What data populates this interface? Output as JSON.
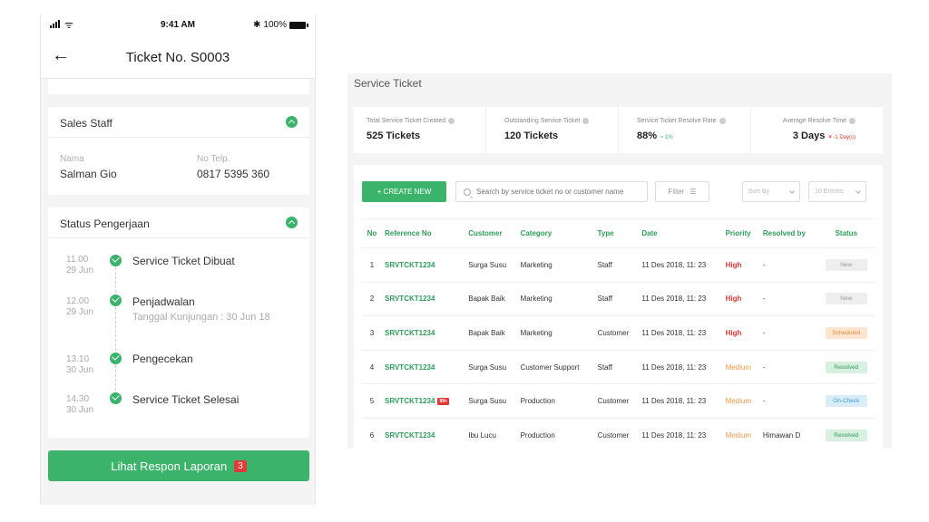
{
  "mobile": {
    "status_bar": {
      "time": "9:41 AM",
      "battery": "100%",
      "wifi_glyph": "ᯤ",
      "bt_glyph": "✱"
    },
    "header": {
      "back_glyph": "←",
      "title": "Ticket No. S0003"
    },
    "sales": {
      "title": "Sales Staff",
      "name_label": "Nama",
      "name_value": "Salman Gio",
      "phone_label": "No Telp.",
      "phone_value": "0817 5395 360"
    },
    "status": {
      "title": "Status Pengerjaan",
      "steps": [
        {
          "time": "11.00",
          "date": "29 Jun",
          "text": "Service Ticket Dibuat",
          "sub": ""
        },
        {
          "time": "12.00",
          "date": "29 Jun",
          "text": "Penjadwalan",
          "sub": "Tanggal Kunjungan : 30 Jun 18"
        },
        {
          "time": "13.10",
          "date": "30 Jun",
          "text": "Pengecekan",
          "sub": ""
        },
        {
          "time": "14.30",
          "date": "30 Jun",
          "text": "Service Ticket Selesai",
          "sub": ""
        }
      ]
    },
    "cta": {
      "label": "Lihat Respon Laporan",
      "badge": "3"
    }
  },
  "desktop": {
    "title": "Service Ticket",
    "stats": [
      {
        "label": "Total Service Ticket Created",
        "value": "525 Tickets",
        "delta": ""
      },
      {
        "label": "Outstanding Service Ticket",
        "value": "120 Tickets",
        "delta": ""
      },
      {
        "label": "Service Ticket Resolve Rate",
        "value": "88%",
        "delta": "≈ 1%"
      },
      {
        "label": "Average Resolve Time",
        "value": "3 Days",
        "delta": "¥ -1 Day(s)"
      }
    ],
    "toolbar": {
      "create_label": "+ CREATE NEW",
      "search_placeholder": "Search by service ticket no or customer name",
      "filter_label": "Filter",
      "filter_glyph": "☰",
      "sort_label": "Sort By",
      "entries_label": "10 Entries"
    },
    "table": {
      "headers": [
        "No",
        "Reference No",
        "Customer",
        "Category",
        "Type",
        "Date",
        "Priority",
        "Resolved by",
        "Status"
      ],
      "rows": [
        {
          "no": "1",
          "ref": "SRVTCKT1234",
          "tag": "",
          "customer": "Surga Susu",
          "category": "Marketing",
          "type": "Staff",
          "date": "11 Des 2018, 11: 23",
          "priority": "High",
          "resolved": "-",
          "status": "New"
        },
        {
          "no": "2",
          "ref": "SRVTCKT1234",
          "tag": "",
          "customer": "Bapak Baik",
          "category": "Marketing",
          "type": "Staff",
          "date": "11 Des 2018, 11: 23",
          "priority": "High",
          "resolved": "-",
          "status": "New"
        },
        {
          "no": "3",
          "ref": "SRVTCKT1234",
          "tag": "",
          "customer": "Bapak Baik",
          "category": "Marketing",
          "type": "Customer",
          "date": "11 Des 2018, 11: 23",
          "priority": "High",
          "resolved": "-",
          "status": "Scheduled"
        },
        {
          "no": "4",
          "ref": "SRVTCKT1234",
          "tag": "",
          "customer": "Surga Susu",
          "category": "Customer Support",
          "type": "Staff",
          "date": "11 Des 2018, 11: 23",
          "priority": "Medium",
          "resolved": "-",
          "status": "Resolved"
        },
        {
          "no": "5",
          "ref": "SRVTCKT1234",
          "tag": "99+",
          "customer": "Surga Susu",
          "category": "Production",
          "type": "Customer",
          "date": "11 Des 2018, 11: 23",
          "priority": "Medium",
          "resolved": "-",
          "status": "On-Check"
        },
        {
          "no": "6",
          "ref": "SRVTCKT1234",
          "tag": "",
          "customer": "Ibu Lucu",
          "category": "Production",
          "type": "Customer",
          "date": "11 Des 2018, 11: 23",
          "priority": "Medium",
          "resolved": "Himawan D",
          "status": "Resolved"
        }
      ]
    }
  },
  "colors": {
    "accent": "#3bb36a",
    "danger": "#e53935",
    "warning": "#f2994a",
    "info": "#3b9ad9"
  }
}
